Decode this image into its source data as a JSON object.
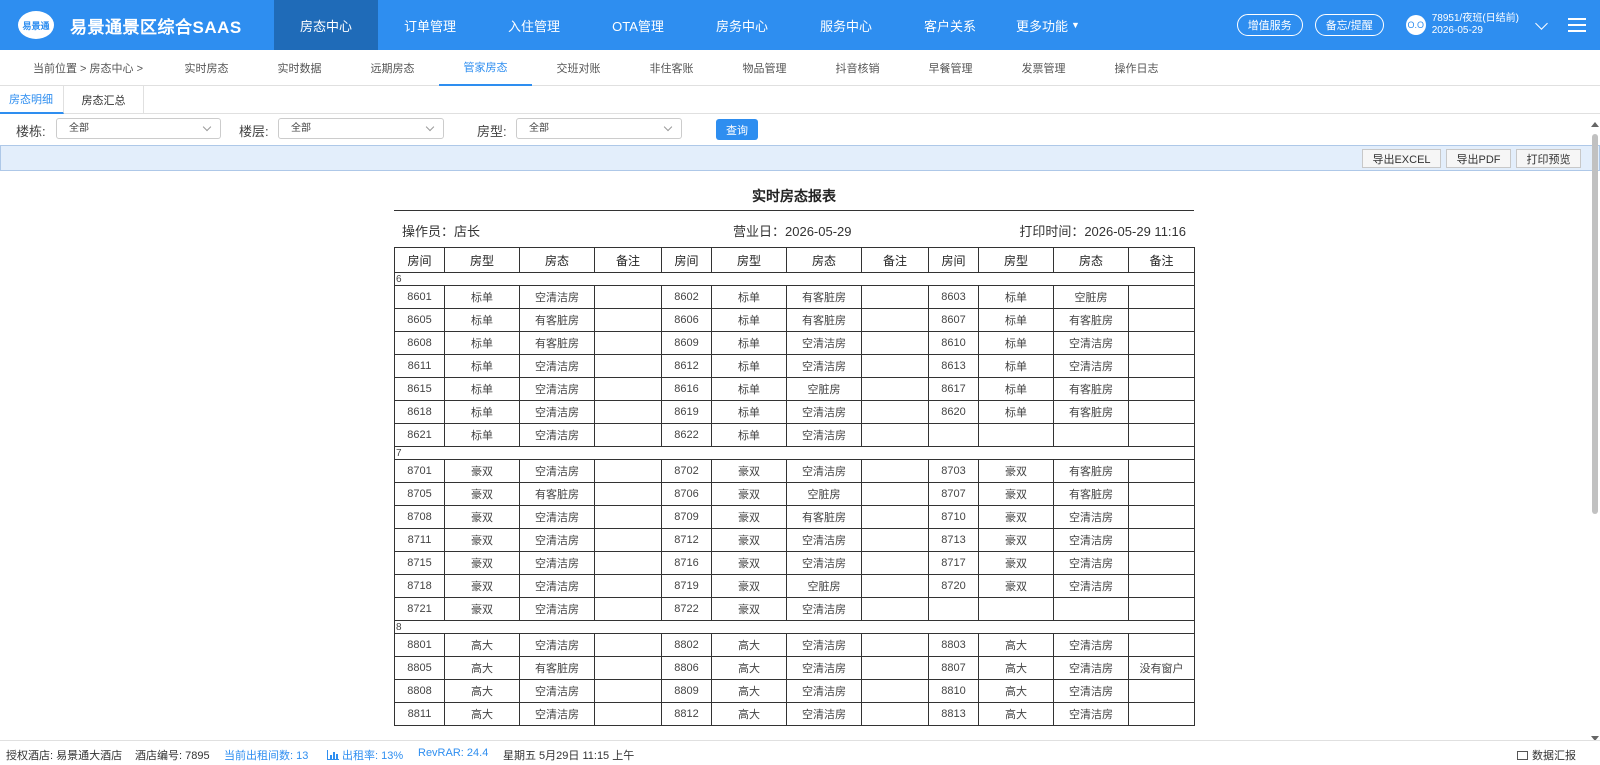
{
  "app": {
    "logo_badge": "易景通",
    "title": "易景通景区综合SAAS"
  },
  "nav": [
    {
      "label": "房态中心",
      "active": true
    },
    {
      "label": "订单管理"
    },
    {
      "label": "入住管理"
    },
    {
      "label": "OTA管理"
    },
    {
      "label": "房务中心"
    },
    {
      "label": "服务中心"
    },
    {
      "label": "客户关系"
    },
    {
      "label": "更多功能"
    }
  ],
  "header_right": {
    "value_added": "增值服务",
    "memo": "备忘/提醒",
    "avatar": "O.O",
    "user_line1": "78951/夜班(日结前)",
    "user_line2": "2026-05-29"
  },
  "subnav": {
    "breadcrumb": "当前位置 >  房态中心 >",
    "tabs": [
      "实时房态",
      "实时数据",
      "远期房态",
      "管家房态",
      "交班对账",
      "非住客账",
      "物品管理",
      "抖音核销",
      "早餐管理",
      "发票管理",
      "操作日志"
    ],
    "active_index": 3
  },
  "view_tabs": [
    "房态明细",
    "房态汇总"
  ],
  "filters": {
    "building_label": "楼栋:",
    "building_value": "全部",
    "floor_label": "楼层:",
    "floor_value": "全部",
    "roomtype_label": "房型:",
    "roomtype_value": "全部",
    "query": "查询"
  },
  "toolbar": {
    "export_excel": "导出EXCEL",
    "export_pdf": "导出PDF",
    "print_preview": "打印预览"
  },
  "report": {
    "title": "实时房态报表",
    "operator": "操作员：店长",
    "business_day": "营业日：2026-05-29",
    "print_time": "打印时间：2026-05-29 11:16",
    "headers": [
      "房间",
      "房型",
      "房态",
      "备注",
      "房间",
      "房型",
      "房态",
      "备注",
      "房间",
      "房型",
      "房态",
      "备注"
    ],
    "floors": [
      {
        "floor": "6",
        "rows": [
          [
            "8601",
            "标单",
            "空清洁房",
            "",
            "8602",
            "标单",
            "有客脏房",
            "",
            "8603",
            "标单",
            "空脏房",
            ""
          ],
          [
            "8605",
            "标单",
            "有客脏房",
            "",
            "8606",
            "标单",
            "有客脏房",
            "",
            "8607",
            "标单",
            "有客脏房",
            ""
          ],
          [
            "8608",
            "标单",
            "有客脏房",
            "",
            "8609",
            "标单",
            "空清洁房",
            "",
            "8610",
            "标单",
            "空清洁房",
            ""
          ],
          [
            "8611",
            "标单",
            "空清洁房",
            "",
            "8612",
            "标单",
            "空清洁房",
            "",
            "8613",
            "标单",
            "空清洁房",
            ""
          ],
          [
            "8615",
            "标单",
            "空清洁房",
            "",
            "8616",
            "标单",
            "空脏房",
            "",
            "8617",
            "标单",
            "有客脏房",
            ""
          ],
          [
            "8618",
            "标单",
            "空清洁房",
            "",
            "8619",
            "标单",
            "空清洁房",
            "",
            "8620",
            "标单",
            "有客脏房",
            ""
          ],
          [
            "8621",
            "标单",
            "空清洁房",
            "",
            "8622",
            "标单",
            "空清洁房",
            "",
            "",
            "",
            "",
            ""
          ]
        ]
      },
      {
        "floor": "7",
        "rows": [
          [
            "8701",
            "豪双",
            "空清洁房",
            "",
            "8702",
            "豪双",
            "空清洁房",
            "",
            "8703",
            "豪双",
            "有客脏房",
            ""
          ],
          [
            "8705",
            "豪双",
            "有客脏房",
            "",
            "8706",
            "豪双",
            "空脏房",
            "",
            "8707",
            "豪双",
            "有客脏房",
            ""
          ],
          [
            "8708",
            "豪双",
            "空清洁房",
            "",
            "8709",
            "豪双",
            "有客脏房",
            "",
            "8710",
            "豪双",
            "空清洁房",
            ""
          ],
          [
            "8711",
            "豪双",
            "空清洁房",
            "",
            "8712",
            "豪双",
            "空清洁房",
            "",
            "8713",
            "豪双",
            "空清洁房",
            ""
          ],
          [
            "8715",
            "豪双",
            "空清洁房",
            "",
            "8716",
            "豪双",
            "空清洁房",
            "",
            "8717",
            "豪双",
            "空清洁房",
            ""
          ],
          [
            "8718",
            "豪双",
            "空清洁房",
            "",
            "8719",
            "豪双",
            "空脏房",
            "",
            "8720",
            "豪双",
            "空清洁房",
            ""
          ],
          [
            "8721",
            "豪双",
            "空清洁房",
            "",
            "8722",
            "豪双",
            "空清洁房",
            "",
            "",
            "",
            "",
            ""
          ]
        ]
      },
      {
        "floor": "8",
        "rows": [
          [
            "8801",
            "高大",
            "空清洁房",
            "",
            "8802",
            "高大",
            "空清洁房",
            "",
            "8803",
            "高大",
            "空清洁房",
            ""
          ],
          [
            "8805",
            "高大",
            "有客脏房",
            "",
            "8806",
            "高大",
            "空清洁房",
            "",
            "8807",
            "高大",
            "空清洁房",
            "没有窗户"
          ],
          [
            "8808",
            "高大",
            "空清洁房",
            "",
            "8809",
            "高大",
            "空清洁房",
            "",
            "8810",
            "高大",
            "空清洁房",
            ""
          ],
          [
            "8811",
            "高大",
            "空清洁房",
            "",
            "8812",
            "高大",
            "空清洁房",
            "",
            "8813",
            "高大",
            "空清洁房",
            ""
          ]
        ]
      }
    ]
  },
  "statusbar": {
    "hotel": "授权酒店: 易景通大酒店",
    "hotel_code": "酒店编号: 7895",
    "rented_rooms": "当前出租间数: 13",
    "occupancy": "出租率: 13%",
    "revrar": "RevRAR: 24.4",
    "datetime": "星期五 5月29日 11:15 上午",
    "data_report": "数据汇报"
  },
  "colors": {
    "brand": "#2e8ef0",
    "nav_active": "#1f6bb8",
    "toolbar_bg": "#e3eefb"
  }
}
